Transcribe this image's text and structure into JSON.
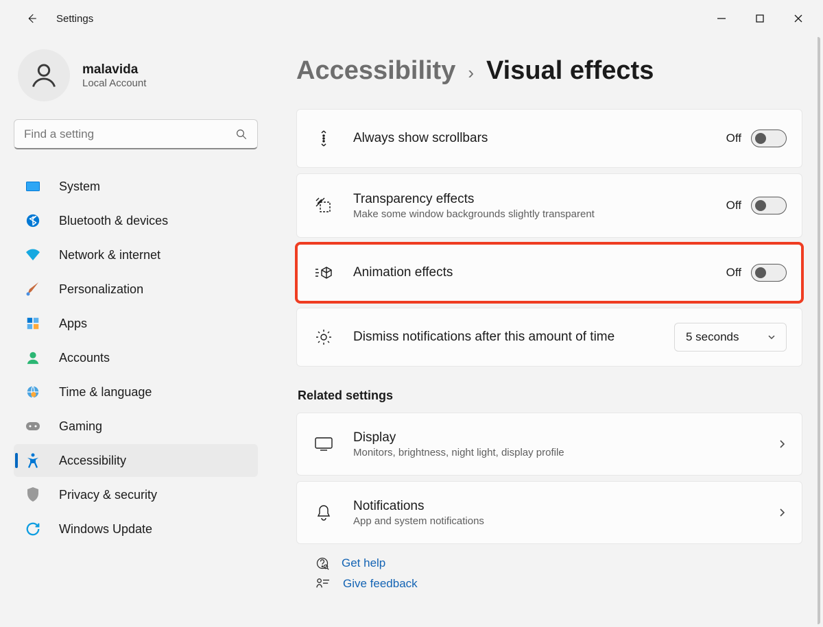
{
  "titlebar": {
    "title": "Settings"
  },
  "user": {
    "name": "malavida",
    "sub": "Local Account"
  },
  "search": {
    "placeholder": "Find a setting"
  },
  "nav": {
    "items": [
      {
        "label": "System"
      },
      {
        "label": "Bluetooth & devices"
      },
      {
        "label": "Network & internet"
      },
      {
        "label": "Personalization"
      },
      {
        "label": "Apps"
      },
      {
        "label": "Accounts"
      },
      {
        "label": "Time & language"
      },
      {
        "label": "Gaming"
      },
      {
        "label": "Accessibility"
      },
      {
        "label": "Privacy & security"
      },
      {
        "label": "Windows Update"
      }
    ]
  },
  "breadcrumb": {
    "parent": "Accessibility",
    "current": "Visual effects"
  },
  "settings": {
    "scrollbars": {
      "title": "Always show scrollbars",
      "state": "Off"
    },
    "transparency": {
      "title": "Transparency effects",
      "sub": "Make some window backgrounds slightly transparent",
      "state": "Off"
    },
    "animation": {
      "title": "Animation effects",
      "state": "Off"
    },
    "dismiss": {
      "title": "Dismiss notifications after this amount of time",
      "value": "5 seconds"
    }
  },
  "related": {
    "heading": "Related settings",
    "display": {
      "title": "Display",
      "sub": "Monitors, brightness, night light, display profile"
    },
    "notifications": {
      "title": "Notifications",
      "sub": "App and system notifications"
    }
  },
  "footer": {
    "help": "Get help",
    "feedback": "Give feedback"
  }
}
